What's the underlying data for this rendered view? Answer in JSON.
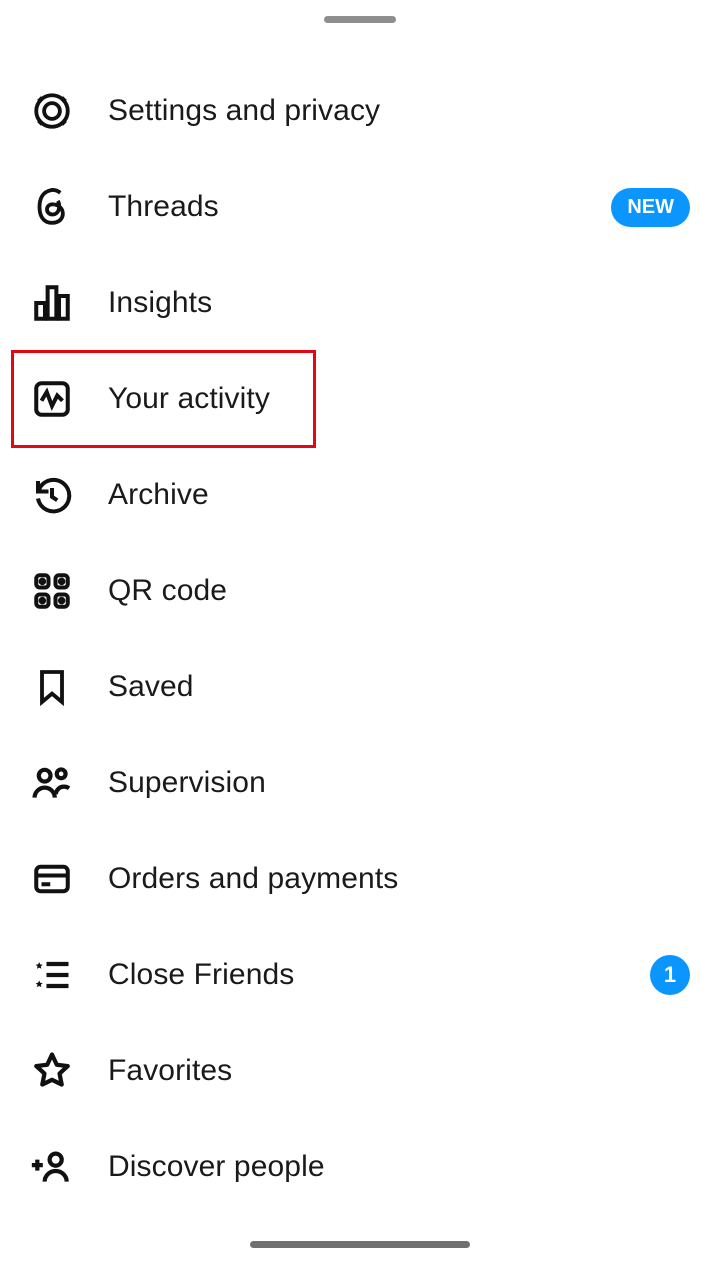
{
  "colors": {
    "accent": "#0a95ff",
    "highlight": "#e30613"
  },
  "menu": {
    "items": [
      {
        "label": "Settings and privacy",
        "icon": "gear-icon"
      },
      {
        "label": "Threads",
        "icon": "threads-icon",
        "badgeNew": "NEW"
      },
      {
        "label": "Insights",
        "icon": "bar-chart-icon"
      },
      {
        "label": "Your activity",
        "icon": "activity-icon",
        "highlighted": true
      },
      {
        "label": "Archive",
        "icon": "history-icon"
      },
      {
        "label": "QR code",
        "icon": "qr-code-icon"
      },
      {
        "label": "Saved",
        "icon": "bookmark-icon"
      },
      {
        "label": "Supervision",
        "icon": "family-icon"
      },
      {
        "label": "Orders and payments",
        "icon": "credit-card-icon"
      },
      {
        "label": "Close Friends",
        "icon": "star-list-icon",
        "badgeCount": "1"
      },
      {
        "label": "Favorites",
        "icon": "star-icon"
      },
      {
        "label": "Discover people",
        "icon": "add-person-icon"
      }
    ]
  }
}
